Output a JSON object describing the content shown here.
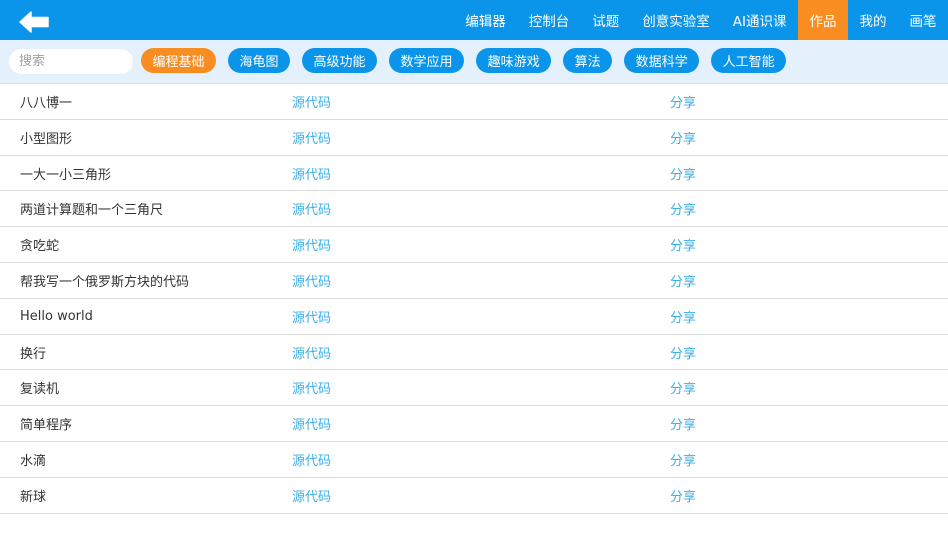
{
  "header": {
    "back_icon": "arrow-left-icon",
    "nav": [
      {
        "label": "编辑器",
        "active": false
      },
      {
        "label": "控制台",
        "active": false
      },
      {
        "label": "试题",
        "active": false
      },
      {
        "label": "创意实验室",
        "active": false
      },
      {
        "label": "AI通识课",
        "active": false
      },
      {
        "label": "作品",
        "active": true
      },
      {
        "label": "我的",
        "active": false
      },
      {
        "label": "画笔",
        "active": false
      }
    ]
  },
  "filters": {
    "search_placeholder": "搜索",
    "categories": [
      {
        "label": "编程基础",
        "active": true
      },
      {
        "label": "海龟图",
        "active": false
      },
      {
        "label": "高级功能",
        "active": false
      },
      {
        "label": "数学应用",
        "active": false
      },
      {
        "label": "趣味游戏",
        "active": false
      },
      {
        "label": "算法",
        "active": false
      },
      {
        "label": "数据科学",
        "active": false
      },
      {
        "label": "人工智能",
        "active": false
      }
    ]
  },
  "works": [
    {
      "title": "八八博一",
      "source": "源代码",
      "share": "分享"
    },
    {
      "title": "小型图形",
      "source": "源代码",
      "share": "分享"
    },
    {
      "title": "一大一小三角形",
      "source": "源代码",
      "share": "分享"
    },
    {
      "title": "两道计算题和一个三角尺",
      "source": "源代码",
      "share": "分享"
    },
    {
      "title": "贪吃蛇",
      "source": "源代码",
      "share": "分享"
    },
    {
      "title": "帮我写一个俄罗斯方块的代码",
      "source": "源代码",
      "share": "分享"
    },
    {
      "title": "Hello world",
      "source": "源代码",
      "share": "分享"
    },
    {
      "title": "换行",
      "source": "源代码",
      "share": "分享"
    },
    {
      "title": "复读机",
      "source": "源代码",
      "share": "分享"
    },
    {
      "title": "简单程序",
      "source": "源代码",
      "share": "分享"
    },
    {
      "title": "水滴",
      "source": "源代码",
      "share": "分享"
    },
    {
      "title": "新球",
      "source": "源代码",
      "share": "分享"
    }
  ],
  "colors": {
    "primary": "#0a95ea",
    "accent": "#f98d22",
    "link": "#3aaee8",
    "filter_bg": "#e4f1fd"
  }
}
